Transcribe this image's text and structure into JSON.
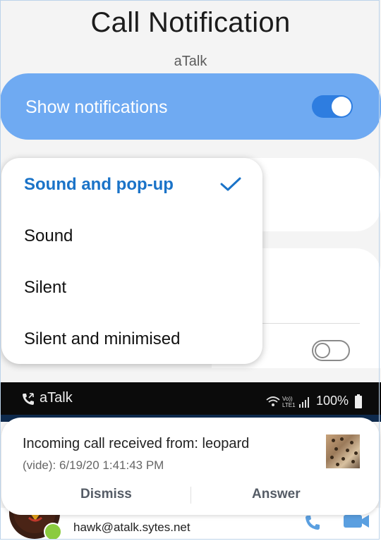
{
  "header": {
    "title": "Call Notification",
    "app_name": "aTalk"
  },
  "show_notifications": {
    "label": "Show notifications",
    "enabled": true
  },
  "dropdown": {
    "options": [
      {
        "label": "Sound and pop-up",
        "selected": true
      },
      {
        "label": "Sound",
        "selected": false
      },
      {
        "label": "Silent",
        "selected": false
      },
      {
        "label": "Silent and minimised",
        "selected": false
      }
    ]
  },
  "background_toggle": {
    "enabled": false
  },
  "status_bar": {
    "app_name": "aTalk",
    "battery": "100%",
    "network_label": "Vo)) LTE1"
  },
  "notification": {
    "message": "Incoming call received from: leopard",
    "detail": "(vide): 6/19/20 1:41:43 PM",
    "dismiss_label": "Dismiss",
    "answer_label": "Answer"
  },
  "contact": {
    "email": "hawk@atalk.sytes.net",
    "status": "online"
  },
  "colors": {
    "accent": "#6faaf2",
    "toggle_on": "#2e7de0",
    "selected_text": "#1a73c8",
    "status_online": "#8bcb3f"
  }
}
